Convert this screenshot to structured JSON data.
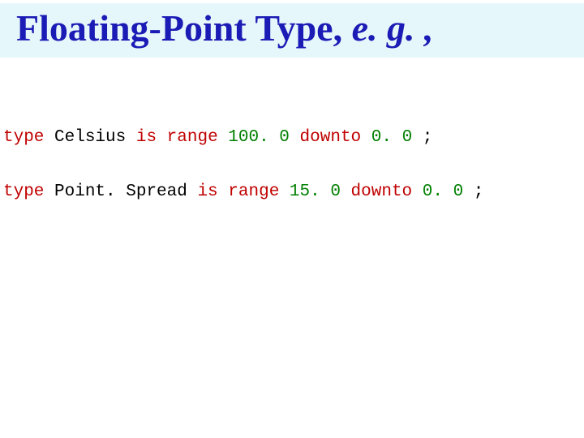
{
  "title": {
    "main": "Floating-Point Type, ",
    "eg": "e. g. ,"
  },
  "code": {
    "line1": {
      "kw_type": "type",
      "ident": " Celsius ",
      "kw_is": "is",
      "sp1": " ",
      "kw_range": "range",
      "sp2": " ",
      "num1": "100. 0",
      "sp3": " ",
      "kw_downto": "downto",
      "sp4": " ",
      "num2": "0. 0",
      "tail": " ;"
    },
    "line2": {
      "kw_type": "type",
      "ident": " Point. Spread ",
      "kw_is": "is",
      "sp1": " ",
      "kw_range": "range",
      "sp2": " ",
      "num1": "15. 0",
      "sp3": " ",
      "kw_downto": "downto",
      "sp4": " ",
      "num2": "0. 0",
      "tail": " ;"
    }
  }
}
